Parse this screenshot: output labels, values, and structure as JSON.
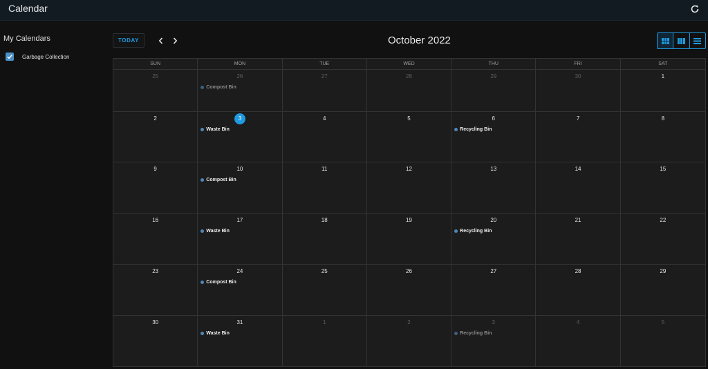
{
  "app": {
    "title": "Calendar"
  },
  "sidebar": {
    "heading": "My Calendars",
    "calendars": [
      {
        "label": "Garbage Collection",
        "checked": true,
        "color": "#4a8fc6"
      }
    ]
  },
  "toolbar": {
    "today_label": "TODAY",
    "month_title": "October 2022",
    "views": [
      "month-view-icon",
      "week-view-icon",
      "list-view-icon"
    ],
    "active_view": 0
  },
  "weekdays": [
    "SUN",
    "MON",
    "TUE",
    "WED",
    "THU",
    "FRI",
    "SAT"
  ],
  "weeks": [
    [
      {
        "day": "25",
        "other": true
      },
      {
        "day": "26",
        "other": true,
        "event": "Compost Bin"
      },
      {
        "day": "27",
        "other": true
      },
      {
        "day": "28",
        "other": true
      },
      {
        "day": "29",
        "other": true
      },
      {
        "day": "30",
        "other": true
      },
      {
        "day": "1"
      }
    ],
    [
      {
        "day": "2"
      },
      {
        "day": "3",
        "today": true,
        "event": "Waste Bin"
      },
      {
        "day": "4"
      },
      {
        "day": "5"
      },
      {
        "day": "6",
        "event": "Recycling Bin"
      },
      {
        "day": "7"
      },
      {
        "day": "8"
      }
    ],
    [
      {
        "day": "9"
      },
      {
        "day": "10",
        "event": "Compost Bin"
      },
      {
        "day": "11"
      },
      {
        "day": "12"
      },
      {
        "day": "13"
      },
      {
        "day": "14"
      },
      {
        "day": "15"
      }
    ],
    [
      {
        "day": "16"
      },
      {
        "day": "17",
        "event": "Waste Bin"
      },
      {
        "day": "18"
      },
      {
        "day": "19"
      },
      {
        "day": "20",
        "event": "Recycling Bin"
      },
      {
        "day": "21"
      },
      {
        "day": "22"
      }
    ],
    [
      {
        "day": "23"
      },
      {
        "day": "24",
        "event": "Compost Bin"
      },
      {
        "day": "25"
      },
      {
        "day": "26"
      },
      {
        "day": "27"
      },
      {
        "day": "28"
      },
      {
        "day": "29"
      }
    ],
    [
      {
        "day": "30"
      },
      {
        "day": "31",
        "event": "Waste Bin"
      },
      {
        "day": "1",
        "other": true
      },
      {
        "day": "2",
        "other": true
      },
      {
        "day": "3",
        "other": true,
        "event": "Recycling Bin"
      },
      {
        "day": "4",
        "other": true
      },
      {
        "day": "5",
        "other": true
      }
    ]
  ],
  "colors": {
    "accent": "#1e9be0",
    "event_dot": "#4f87b8"
  }
}
